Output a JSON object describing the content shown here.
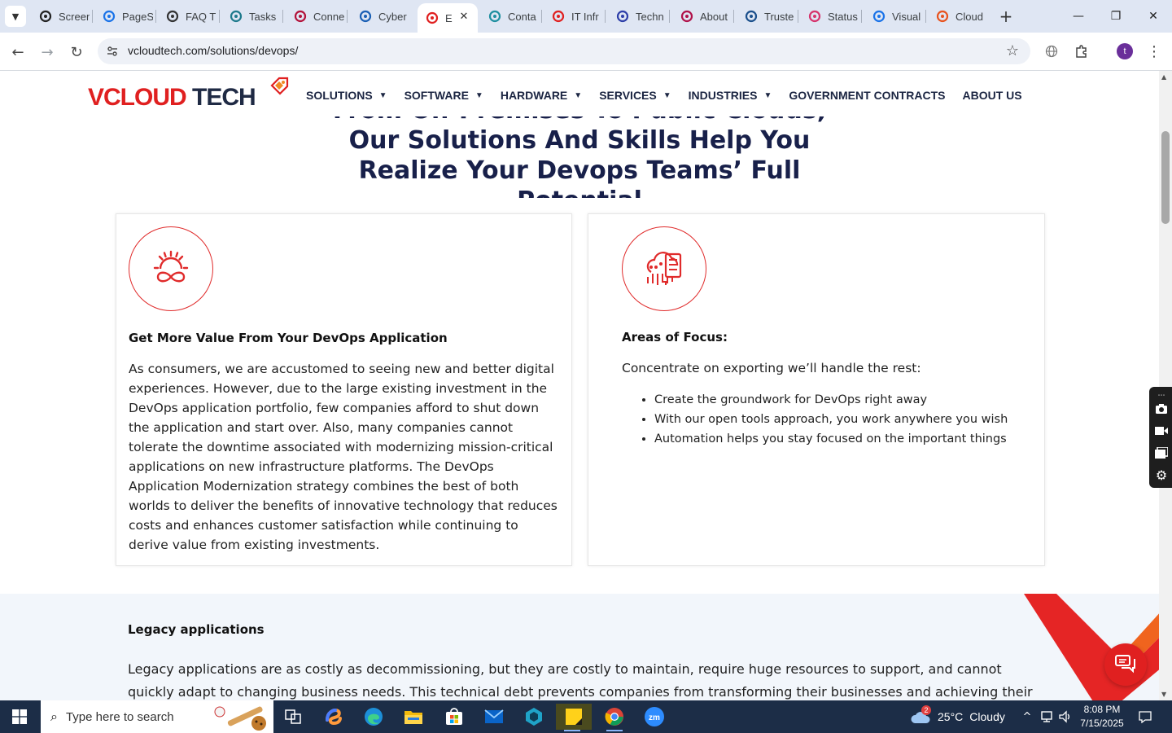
{
  "browser": {
    "tabs": [
      {
        "label": "Screen",
        "icon": "screencastify-icon",
        "color": "#222222"
      },
      {
        "label": "PageS",
        "icon": "pagespeed-icon",
        "color": "#1a73e8"
      },
      {
        "label": "FAQ T",
        "icon": "faq-icon",
        "color": "#333333"
      },
      {
        "label": "Tasks",
        "icon": "tasks-icon",
        "color": "#1e7a8c"
      },
      {
        "label": "Conne",
        "icon": "v-logo-icon",
        "color": "#b3123a"
      },
      {
        "label": "Cyber",
        "icon": "cyber-icon",
        "color": "#1a5fb4"
      },
      {
        "label": "E",
        "icon": "vcloud-icon",
        "color": "#e02020",
        "active": true
      },
      {
        "label": "Conta",
        "icon": "contact-icon",
        "color": "#1e8fa0"
      },
      {
        "label": "IT Infr",
        "icon": "vcloud-icon",
        "color": "#e02020"
      },
      {
        "label": "Techn",
        "icon": "x-logo-icon",
        "color": "#2d3ea8"
      },
      {
        "label": "About",
        "icon": "about-icon",
        "color": "#b0124a"
      },
      {
        "label": "Truste",
        "icon": "scale-icon",
        "color": "#1a4f8c"
      },
      {
        "label": "Status",
        "icon": "status-icon",
        "color": "#d6336c"
      },
      {
        "label": "Visual",
        "icon": "pulse-icon",
        "color": "#1a73e8"
      },
      {
        "label": "Cloud",
        "icon": "cloud-logo-icon",
        "color": "#e8531e"
      }
    ],
    "url": "vcloudtech.com/solutions/devops/"
  },
  "site": {
    "logo": {
      "v": "V",
      "cloud": "CLOUD",
      "tech": "TECH"
    },
    "nav": [
      {
        "label": "SOLUTIONS",
        "dropdown": true
      },
      {
        "label": "SOFTWARE",
        "dropdown": true
      },
      {
        "label": "HARDWARE",
        "dropdown": true
      },
      {
        "label": "SERVICES",
        "dropdown": true
      },
      {
        "label": "INDUSTRIES",
        "dropdown": true
      },
      {
        "label": "GOVERNMENT CONTRACTS",
        "dropdown": false
      },
      {
        "label": "ABOUT US",
        "dropdown": false
      }
    ],
    "hero_title": "From On-Premises To Public Clouds, Our Solutions And Skills Help You Realize Your Devops Teams’ Full Potential",
    "cards": {
      "left": {
        "icon": "gear-infinity-icon",
        "title": "Get More Value From Your DevOps Application",
        "body": "As consumers, we are accustomed to seeing new and better digital experiences. However, due to the large existing investment in the DevOps application portfolio, few companies afford to shut down the application and start over. Also, many companies cannot tolerate the downtime associated with modernizing mission-critical applications on new infrastructure platforms. The DevOps Application Modernization strategy combines the best of both worlds to deliver the benefits of innovative technology that reduces costs and enhances customer satisfaction while continuing to derive value from existing investments."
      },
      "right": {
        "icon": "cloud-server-icon",
        "title": "Areas of Focus:",
        "intro": "Concentrate on exporting we’ll handle the rest:",
        "items": [
          "Create the groundwork for DevOps right away",
          "With our open tools approach, you work anywhere you wish",
          "Automation helps you stay focused on the important things"
        ]
      }
    },
    "legacy": {
      "title": "Legacy applications",
      "body": "Legacy applications are as costly as decommissioning, but they are costly to maintain, require huge resources to support, and cannot quickly adapt to changing business needs. This technical debt prevents companies from transforming their businesses and achieving their goals. Most"
    },
    "accent_color": "#e02020",
    "heading_color": "#18204a"
  },
  "taskbar": {
    "search_placeholder": "Type here to search",
    "weather": {
      "temp": "25°C",
      "condition": "Cloudy",
      "badge": "2"
    },
    "clock": {
      "time": "8:08 PM",
      "date": "7/15/2025"
    }
  }
}
